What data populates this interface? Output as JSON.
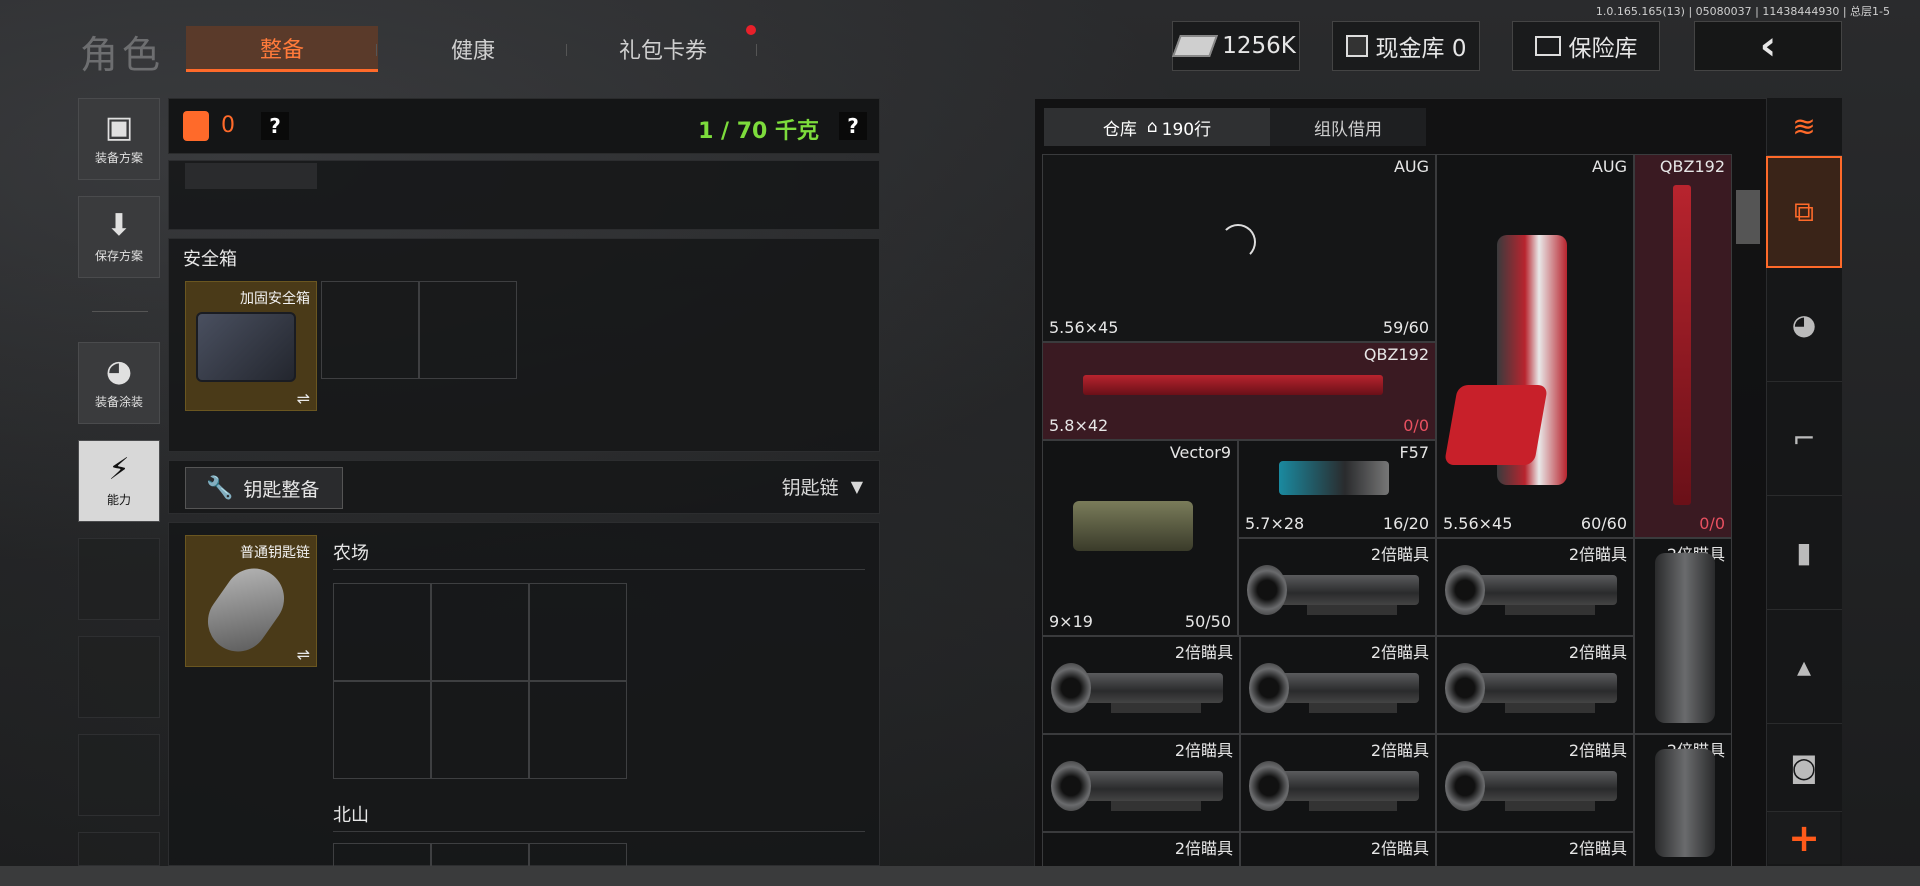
{
  "header": {
    "title": "角色",
    "tabs": [
      "整备",
      "健康",
      "礼包卡券"
    ],
    "version": "1.0.165.165(13) | 05080037 | 11438444930 | 总层1-5",
    "currency_value": "1256K",
    "cash_vault": "现金库 0",
    "insurance_vault": "保险库",
    "back_label": "‹"
  },
  "left_rail": {
    "items": [
      "装备方案",
      "保存方案",
      "装备涂装",
      "能力"
    ]
  },
  "equipment": {
    "armor_count": "0",
    "help": "?",
    "weight": "1 / 70 千克",
    "safebox_title": "安全箱",
    "safebox_item": "加固安全箱",
    "key_button": "钥匙整备",
    "key_dropdown": "钥匙链",
    "key_item": "普通钥匙链",
    "map_farm": "农场",
    "map_north": "北山",
    "swap_icon": "⇌"
  },
  "inventory": {
    "tabs": [
      "仓库",
      "190行",
      "组队借用"
    ],
    "slots": [
      {
        "name": "AUG",
        "caliber": "5.56×45",
        "ammo": "59/60"
      },
      {
        "name": "AUG",
        "caliber": "5.56×45",
        "ammo": "60/60"
      },
      {
        "name": "QBZ192",
        "caliber": "",
        "ammo": "0/0"
      },
      {
        "name": "QBZ192",
        "caliber": "5.8×42",
        "ammo": "0/0"
      },
      {
        "name": "Vector9",
        "caliber": "9×19",
        "ammo": "50/50"
      },
      {
        "name": "F57",
        "caliber": "5.7×28",
        "ammo": "16/20"
      }
    ],
    "scope_name": "2倍瞄具",
    "plus": "+"
  }
}
